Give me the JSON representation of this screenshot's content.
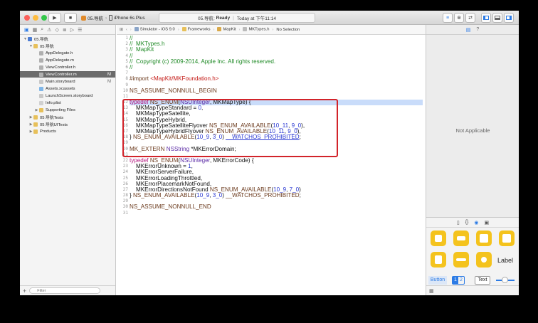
{
  "toolbar": {
    "scheme_name": "05.导航",
    "device": "iPhone 6s Plus",
    "status_project": "05.导航:",
    "status_state": "Ready",
    "status_time": "Today at 下午11:14"
  },
  "jumpbar": {
    "crumbs": [
      "Simulator - iOS 9.0",
      "Frameworks",
      "MapKit",
      "MKTypes.h",
      "No Selection"
    ]
  },
  "navigator": {
    "items": [
      {
        "label": "05.导航",
        "level": 0,
        "type": "project",
        "disclosure": "▼"
      },
      {
        "label": "05.导航",
        "level": 1,
        "type": "folder",
        "disclosure": "▼"
      },
      {
        "label": "AppDelegate.h",
        "level": 2,
        "type": "h"
      },
      {
        "label": "AppDelegate.m",
        "level": 2,
        "type": "m"
      },
      {
        "label": "ViewController.h",
        "level": 2,
        "type": "h"
      },
      {
        "label": "ViewController.m",
        "level": 2,
        "type": "m",
        "badge": "M",
        "selected": true
      },
      {
        "label": "Main.storyboard",
        "level": 2,
        "type": "sb",
        "badge": "M"
      },
      {
        "label": "Assets.xcassets",
        "level": 2,
        "type": "assets"
      },
      {
        "label": "LaunchScreen.storyboard",
        "level": 2,
        "type": "sb"
      },
      {
        "label": "Info.plist",
        "level": 2,
        "type": "plist"
      },
      {
        "label": "Supporting Files",
        "level": 2,
        "type": "folder",
        "disclosure": "▶"
      },
      {
        "label": "05.导航Tests",
        "level": 1,
        "type": "folder",
        "disclosure": "▶"
      },
      {
        "label": "05.导航UITests",
        "level": 1,
        "type": "folder",
        "disclosure": "▶"
      },
      {
        "label": "Products",
        "level": 1,
        "type": "folder",
        "disclosure": "▶"
      }
    ],
    "filter_placeholder": "Filter"
  },
  "editor": {
    "highlighted_line": 12,
    "lines": [
      [
        [
          "c-comment",
          "//"
        ]
      ],
      [
        [
          "c-comment",
          "//  MKTypes.h"
        ]
      ],
      [
        [
          "c-comment",
          "//  MapKit"
        ]
      ],
      [
        [
          "c-comment",
          "//"
        ]
      ],
      [
        [
          "c-comment",
          "//  Copyright (c) 2009-2014, Apple Inc. All rights reserved."
        ]
      ],
      [
        [
          "c-comment",
          "//"
        ]
      ],
      [],
      [
        [
          "c-macro",
          "#import "
        ],
        [
          "c-str",
          "<MapKit/MKFoundation.h>"
        ]
      ],
      [],
      [
        [
          "c-macro",
          "NS_ASSUME_NONNULL_BEGIN"
        ]
      ],
      [],
      [
        [
          "c-kw",
          "typedef "
        ],
        [
          "c-macro",
          "NS_ENUM"
        ],
        [
          "c-plain",
          "("
        ],
        [
          "c-type",
          "NSUInteger"
        ],
        [
          "c-plain",
          ", MKMapType) {"
        ]
      ],
      [
        [
          "c-plain",
          "    MKMapTypeStandard = "
        ],
        [
          "c-num",
          "0"
        ],
        [
          "c-plain",
          ","
        ]
      ],
      [
        [
          "c-plain",
          "    MKMapTypeSatellite,"
        ]
      ],
      [
        [
          "c-plain",
          "    MKMapTypeHybrid,"
        ]
      ],
      [
        [
          "c-plain",
          "    MKMapTypeSatelliteFlyover "
        ],
        [
          "c-macro",
          "NS_ENUM_AVAILABLE"
        ],
        [
          "c-plain",
          "("
        ],
        [
          "c-num",
          "10_11"
        ],
        [
          "c-plain",
          ", "
        ],
        [
          "c-num",
          "9_0"
        ],
        [
          "c-plain",
          "),"
        ]
      ],
      [
        [
          "c-plain",
          "    MKMapTypeHybridFlyover "
        ],
        [
          "c-macro",
          "NS_ENUM_AVAILABLE"
        ],
        [
          "c-plain",
          "("
        ],
        [
          "c-num",
          "10_11"
        ],
        [
          "c-plain",
          ", "
        ],
        [
          "c-num",
          "9_0"
        ],
        [
          "c-plain",
          "),"
        ]
      ],
      [
        [
          "c-plain",
          "} "
        ],
        [
          "c-macro",
          "NS_ENUM_AVAILABLE"
        ],
        [
          "c-plain",
          "("
        ],
        [
          "c-num",
          "10_9"
        ],
        [
          "c-plain",
          ", "
        ],
        [
          "c-num",
          "3_0"
        ],
        [
          "c-plain",
          ") "
        ],
        [
          "c-link",
          "__WATCHOS_PROHIBITED"
        ],
        [
          "c-plain",
          ";"
        ]
      ],
      [],
      [
        [
          "c-macro",
          "MK_EXTERN "
        ],
        [
          "c-type",
          "NSString"
        ],
        [
          "c-plain",
          " *MKErrorDomain;"
        ]
      ],
      [],
      [
        [
          "c-kw",
          "typedef "
        ],
        [
          "c-macro",
          "NS_ENUM"
        ],
        [
          "c-plain",
          "("
        ],
        [
          "c-type",
          "NSUInteger"
        ],
        [
          "c-plain",
          ", MKErrorCode) {"
        ]
      ],
      [
        [
          "c-plain",
          "    MKErrorUnknown = "
        ],
        [
          "c-num",
          "1"
        ],
        [
          "c-plain",
          ","
        ]
      ],
      [
        [
          "c-plain",
          "    MKErrorServerFailure,"
        ]
      ],
      [
        [
          "c-plain",
          "    MKErrorLoadingThrottled,"
        ]
      ],
      [
        [
          "c-plain",
          "    MKErrorPlacemarkNotFound,"
        ]
      ],
      [
        [
          "c-plain",
          "    MKErrorDirectionsNotFound "
        ],
        [
          "c-macro",
          "NS_ENUM_AVAILABLE"
        ],
        [
          "c-plain",
          "("
        ],
        [
          "c-num",
          "10_9"
        ],
        [
          "c-plain",
          ", "
        ],
        [
          "c-num",
          "7_0"
        ],
        [
          "c-plain",
          ")"
        ]
      ],
      [
        [
          "c-plain",
          "} "
        ],
        [
          "c-macro",
          "NS_ENUM_AVAILABLE"
        ],
        [
          "c-plain",
          "("
        ],
        [
          "c-num",
          "10_9"
        ],
        [
          "c-plain",
          ", "
        ],
        [
          "c-num",
          "3_0"
        ],
        [
          "c-plain",
          ") "
        ],
        [
          "c-macro",
          "__WATCHOS_PROHIBITED"
        ],
        [
          "c-plain",
          ";"
        ]
      ],
      [],
      [
        [
          "c-macro",
          "NS_ASSUME_NONNULL_END"
        ]
      ],
      []
    ]
  },
  "inspector": {
    "not_applicable": "Not Applicable",
    "library_label": "Label",
    "button_label": "Button",
    "segment_1": "1",
    "segment_2": "2",
    "text_label": "Text"
  },
  "colors": {
    "selection": "#c9dcfa",
    "annotation": "#d2232a",
    "object_yellow": "#f4c31d",
    "accent_blue": "#2c7be5"
  }
}
